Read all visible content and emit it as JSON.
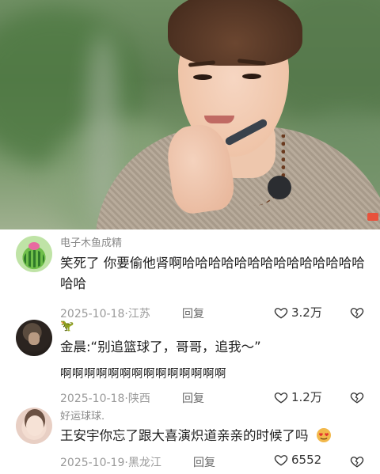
{
  "comments": [
    {
      "username": "电子木鱼成精",
      "text": "笑死了 你要偷他肾啊哈哈哈哈哈哈哈哈哈哈哈哈哈哈哈哈",
      "date": "2025-10-18",
      "location": "江苏",
      "reply_label": "回复",
      "likes": "3.2万",
      "avatar_icon": "watermelon-cartoon-avatar"
    },
    {
      "username": "🦖",
      "text_line1": "金晨:“别追篮球了，哥哥，追我～”",
      "text_line2": "啊啊啊啊啊啊啊啊啊啊啊啊啊啊",
      "date": "2025-10-18",
      "location": "陕西",
      "reply_label": "回复",
      "likes": "1.2万",
      "avatar_icon": "portrait-photo-avatar"
    },
    {
      "username": "好运球球.",
      "text": "王安宇你忘了跟大喜演炽道亲亲的时候了吗",
      "trailing_emoji": "heart-eyes-emoji",
      "date": "2025-10-19",
      "location": "黑龙江",
      "reply_label": "回复",
      "likes": "6552",
      "avatar_icon": "baby-photo-avatar"
    }
  ],
  "colors": {
    "meta_gray": "#9a9a9a",
    "username_gray": "#8a8a8a",
    "text": "#1f1f1f"
  }
}
